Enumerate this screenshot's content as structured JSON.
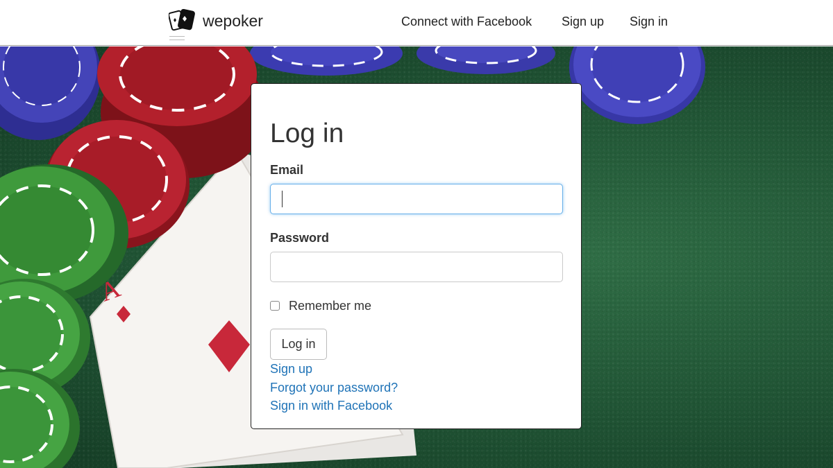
{
  "brand": {
    "name": "wepoker"
  },
  "nav": {
    "connect_facebook": "Connect with Facebook",
    "sign_up": "Sign up",
    "sign_in": "Sign in"
  },
  "login": {
    "title": "Log in",
    "email_label": "Email",
    "email_value": "",
    "password_label": "Password",
    "password_value": "",
    "remember_label": "Remember me",
    "remember_checked": false,
    "submit_label": "Log in",
    "links": {
      "sign_up": "Sign up",
      "forgot_password": "Forgot your password?",
      "facebook": "Sign in with Facebook"
    }
  },
  "colors": {
    "link": "#1f73b7",
    "focus_border": "#66afe9",
    "felt_green": "#1f5233",
    "chip_blue": "#3f3fb0",
    "chip_red": "#b3202c",
    "chip_green": "#3f9a3c"
  },
  "background": {
    "description_icons": [
      "poker-chips",
      "playing-cards"
    ]
  }
}
